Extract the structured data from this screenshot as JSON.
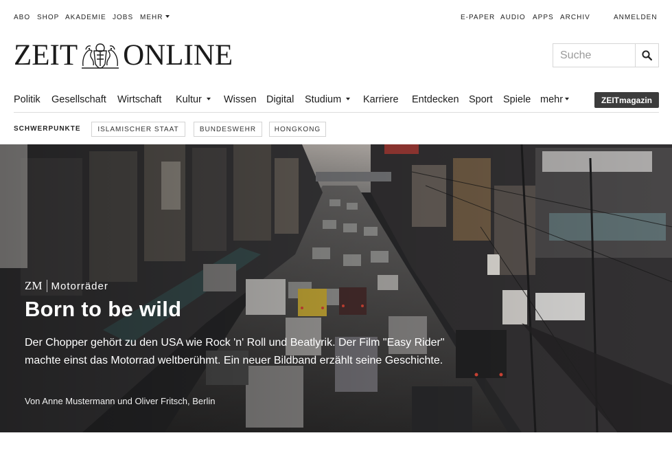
{
  "topbar": {
    "left": [
      "ABO",
      "SHOP",
      "AKADEMIE",
      "JOBS",
      "MEHR"
    ],
    "right": [
      "E-PAPER",
      "AUDIO",
      "APPS",
      "ARCHIV"
    ],
    "login": "ANMELDEN"
  },
  "logo": {
    "left": "ZEIT",
    "right": "ONLINE"
  },
  "search": {
    "placeholder": "Suche"
  },
  "nav": {
    "items": [
      "Politik",
      "Gesellschaft",
      "Wirtschaft",
      "Kultur",
      "Wissen",
      "Digital",
      "Studium",
      "Karriere",
      "Entdecken",
      "Sport",
      "Spiele",
      "mehr"
    ],
    "zeitmagazin": "ZEITmagazin"
  },
  "schwerpunkte": {
    "label": "SCHWERPUNKTE",
    "chips": [
      "ISLAMISCHER STAAT",
      "BUNDESWEHR",
      "HONGKONG"
    ]
  },
  "teaser": {
    "zm": "ZM",
    "kicker": "Motorräder",
    "headline": "Born to be wild",
    "summary": "Der Chopper gehört zu den USA wie Rock 'n' Roll und Beatlyrik. Der Film \"Easy Rider\" machte einst das Motorrad weltberühmt. Ein neuer Bildband erzählt seine Geschichte.",
    "byline": "Von Anne Mustermann und Oliver Fritsch, Berlin"
  },
  "colors": {
    "text": "#252525",
    "zeitmagazin_bg": "#3c3c3c",
    "border": "#d6d6d6"
  }
}
